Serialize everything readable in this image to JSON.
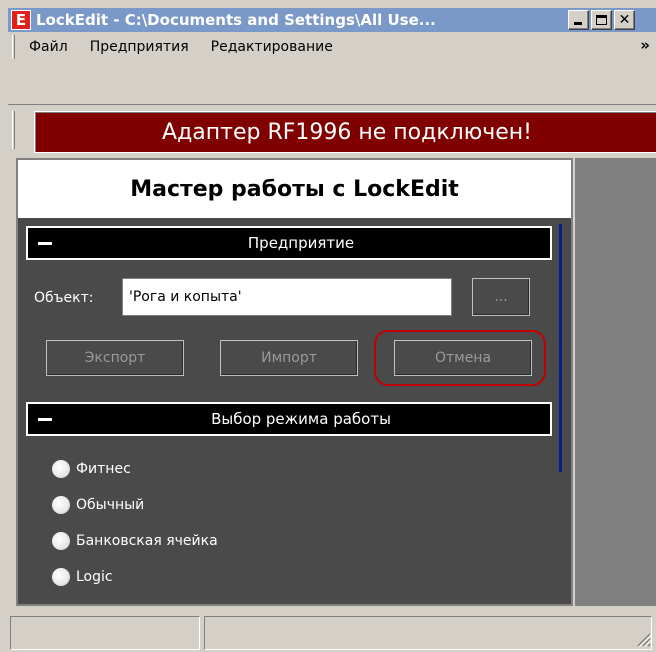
{
  "window": {
    "app_icon_letter": "E",
    "title": "LockEdit - C:\\Documents and Settings\\All Use..."
  },
  "menu": {
    "items": [
      "Файл",
      "Предприятия",
      "Редактирование"
    ],
    "overflow": "»"
  },
  "banner": {
    "text": "Адаптер RF1996 не подключен!",
    "color": "#800000"
  },
  "wizard": {
    "title": "Мастер работы с LockEdit"
  },
  "enterprise": {
    "title": "Предприятие",
    "object_label": "Объект:",
    "object_value": "'Рога и копыта'",
    "browse_label": "...",
    "export_label": "Экспорт",
    "import_label": "Импорт",
    "cancel_label": "Отмена"
  },
  "mode": {
    "title": "Выбор режима работы",
    "options": [
      "Фитнес",
      "Обычный",
      "Банковская ячейка",
      "Logic"
    ]
  },
  "colors": {
    "panel": "#4a4a4a",
    "highlight": "#c00000",
    "titlebar": "#7a98c8"
  }
}
